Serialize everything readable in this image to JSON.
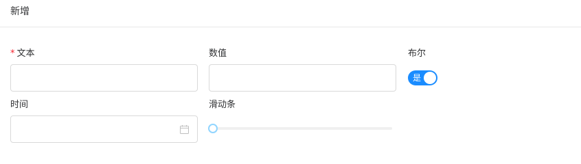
{
  "header": {
    "title": "新增"
  },
  "form": {
    "text_field": {
      "label": "文本",
      "required": true,
      "value": "",
      "placeholder": ""
    },
    "number_field": {
      "label": "数值",
      "value": "",
      "placeholder": ""
    },
    "boolean_field": {
      "label": "布尔",
      "on_text": "是",
      "checked": true
    },
    "time_field": {
      "label": "时间",
      "value": "",
      "placeholder": ""
    },
    "slider_field": {
      "label": "滑动条",
      "value": 0,
      "min": 0,
      "max": 100
    }
  },
  "colors": {
    "switch_on": "#1a8cff",
    "required_star": "#f5222d",
    "slider_handle_border": "#91d5ff",
    "slider_track": "#f0f0f0",
    "input_border": "#d9d9d9"
  },
  "icons": {
    "date_picker": "calendar-icon"
  }
}
